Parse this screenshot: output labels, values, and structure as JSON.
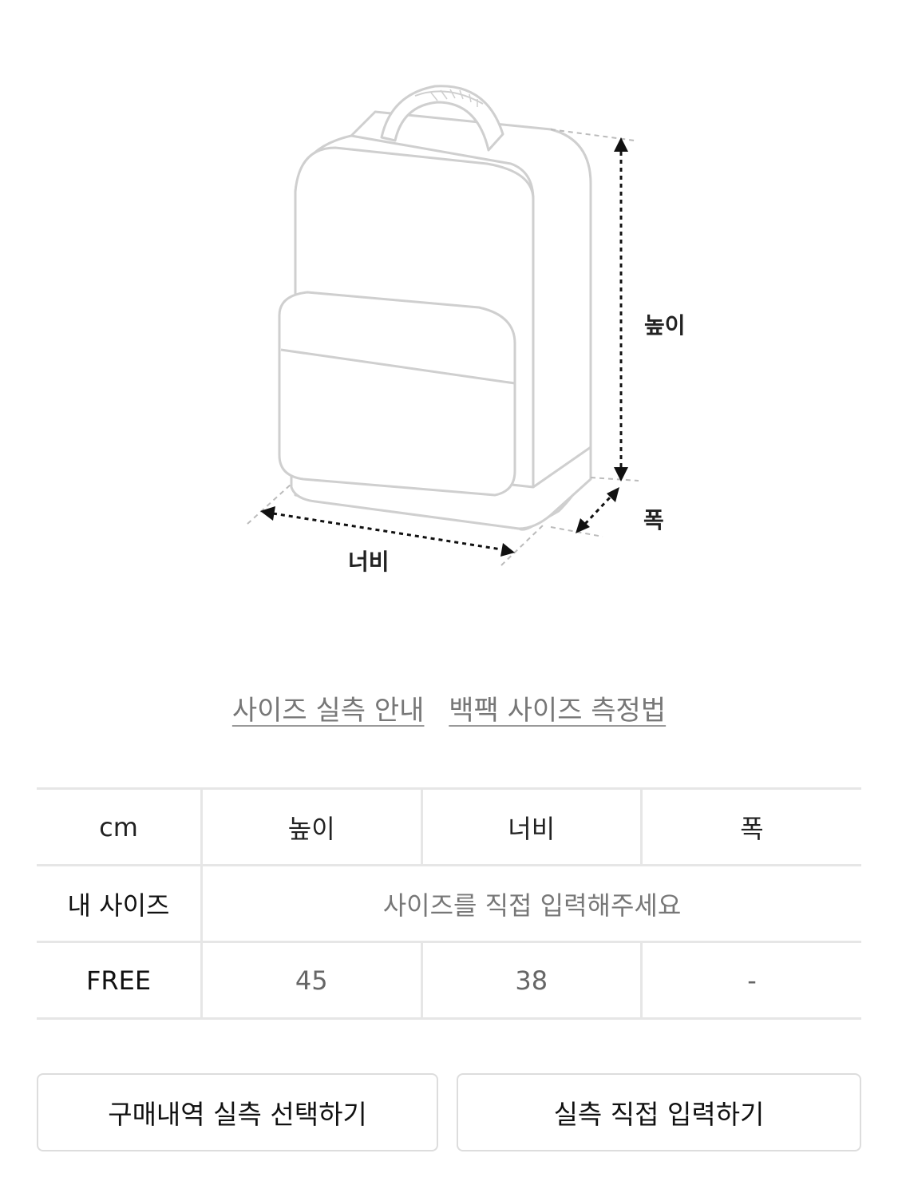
{
  "illustration": {
    "labels": {
      "height": "높이",
      "width": "너비",
      "depth": "폭"
    }
  },
  "links": {
    "size_guide": "사이즈 실측 안내",
    "backpack_measure": "백팩 사이즈 측정법"
  },
  "table": {
    "header": [
      "cm",
      "높이",
      "너비",
      "폭"
    ],
    "my_size": {
      "label": "내 사이즈",
      "placeholder": "사이즈를 직접 입력해주세요"
    },
    "rows": [
      {
        "label": "FREE",
        "values": [
          "45",
          "38",
          "-"
        ]
      }
    ]
  },
  "buttons": {
    "select_from_purchase": "구매내역 실측 선택하기",
    "enter_manually": "실측 직접 입력하기"
  },
  "colors": {
    "outline": "#cfcfcf",
    "text": "#222222",
    "muted": "#777777",
    "border": "#e6e6e6"
  },
  "icons": {
    "illustration": "backpack-dimension-diagram"
  }
}
